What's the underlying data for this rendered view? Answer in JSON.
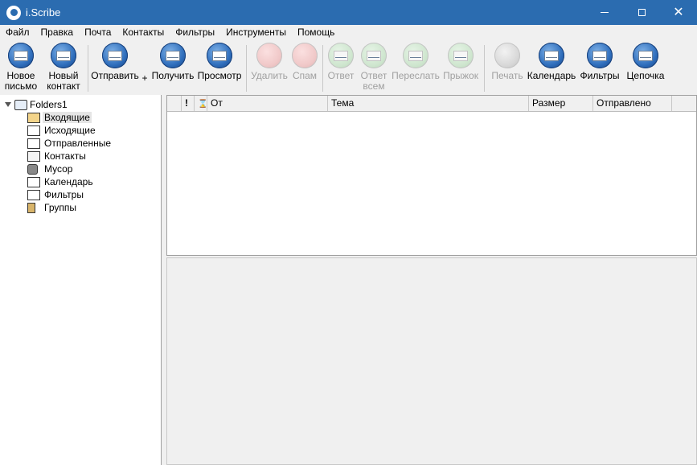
{
  "window": {
    "title": "i.Scribe"
  },
  "menu": [
    "Файл",
    "Правка",
    "Почта",
    "Контакты",
    "Фильтры",
    "Инструменты",
    "Помощь"
  ],
  "toolbar": {
    "new_mail": "Новое\nписьмо",
    "new_contact": "Новый\nконтакт",
    "send": "Отправить",
    "send_plus": "+",
    "receive": "Получить",
    "preview": "Просмотр",
    "delete": "Удалить",
    "spam": "Спам",
    "reply": "Ответ",
    "reply_all": "Ответ\nвсем",
    "forward": "Переслать",
    "bounce": "Прыжок",
    "print": "Печать",
    "calendar": "Календарь",
    "filters": "Фильтры",
    "thread": "Цепочка"
  },
  "folders": {
    "root": "Folders1",
    "items": [
      {
        "label": "Входящие",
        "icon": "inbox-icon",
        "selected": true
      },
      {
        "label": "Исходящие",
        "icon": "outbox-icon"
      },
      {
        "label": "Отправленные",
        "icon": "sent-icon"
      },
      {
        "label": "Контакты",
        "icon": "contacts-icon"
      },
      {
        "label": "Мусор",
        "icon": "trash-icon"
      },
      {
        "label": "Календарь",
        "icon": "calendar-icon"
      },
      {
        "label": "Фильтры",
        "icon": "filters-icon"
      },
      {
        "label": "Группы",
        "icon": "groups-icon"
      }
    ]
  },
  "columns": {
    "priority": "!",
    "flag": "",
    "from": "От",
    "subject": "Тема",
    "size": "Размер",
    "sent": "Отправлено"
  }
}
